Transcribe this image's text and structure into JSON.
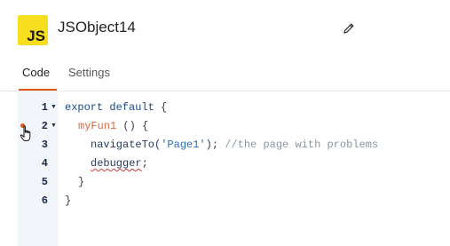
{
  "header": {
    "badge_text": "JS",
    "object_name": "JSObject14",
    "badge_color": "#f7de1e"
  },
  "tabs": [
    {
      "label": "Code",
      "active": true
    },
    {
      "label": "Settings",
      "active": false
    }
  ],
  "accent_color": "#e15615",
  "editor": {
    "line_numbers": [
      "1",
      "2",
      "3",
      "4",
      "5",
      "6"
    ],
    "lines": {
      "l1": {
        "kw": "export default",
        "rest": " {"
      },
      "l2": {
        "fn": "myFun1",
        "rest": " () {"
      },
      "l3": {
        "call": "navigateTo(",
        "str": "'Page1'",
        "mid": "); ",
        "comment": "//the page with problems"
      },
      "l4": {
        "dbg": "debugger",
        "rest": ";"
      },
      "l5": {
        "text": "}"
      },
      "l6": {
        "text": "}"
      }
    }
  },
  "icons": {
    "edit": "pencil-icon",
    "fold": "fold-arrow-icon",
    "breakpoint": "breakpoint-dot",
    "pointer": "hand-pointer-icon"
  }
}
